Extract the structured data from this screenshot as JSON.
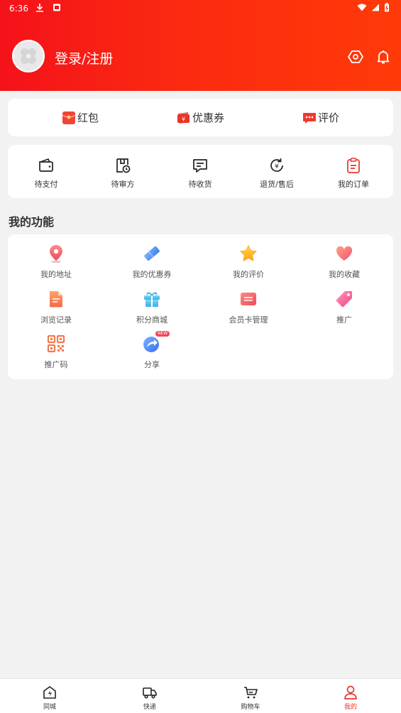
{
  "status_bar": {
    "time": "6:36"
  },
  "header": {
    "login_label": "登录/注册"
  },
  "quick_links": [
    {
      "label": "红包",
      "icon": "red-envelope-icon"
    },
    {
      "label": "优惠券",
      "icon": "coupon-icon"
    },
    {
      "label": "评价",
      "icon": "review-icon"
    }
  ],
  "orders": [
    {
      "label": "待支付",
      "icon": "wallet-icon"
    },
    {
      "label": "待审方",
      "icon": "prescription-review-icon"
    },
    {
      "label": "待收货",
      "icon": "message-icon"
    },
    {
      "label": "退货/售后",
      "icon": "refund-icon"
    },
    {
      "label": "我的订单",
      "icon": "clipboard-icon"
    }
  ],
  "functions_title": "我的功能",
  "functions": [
    {
      "label": "我的地址",
      "icon": "location-pin-icon"
    },
    {
      "label": "我的优惠券",
      "icon": "ticket-icon"
    },
    {
      "label": "我的评价",
      "icon": "star-icon"
    },
    {
      "label": "我的收藏",
      "icon": "heart-icon"
    },
    {
      "label": "浏览记录",
      "icon": "document-icon"
    },
    {
      "label": "积分商城",
      "icon": "gift-icon"
    },
    {
      "label": "会员卡管理",
      "icon": "card-icon"
    },
    {
      "label": "推广",
      "icon": "tag-icon"
    },
    {
      "label": "推广码",
      "icon": "qr-code-icon"
    },
    {
      "label": "分享",
      "icon": "share-icon",
      "badge": "NEW"
    }
  ],
  "tabs": [
    {
      "label": "同城",
      "icon": "home-bolt-icon"
    },
    {
      "label": "快递",
      "icon": "delivery-truck-icon"
    },
    {
      "label": "购物车",
      "icon": "cart-icon"
    },
    {
      "label": "我的",
      "icon": "user-icon",
      "active": true
    }
  ],
  "colors": {
    "brand_red": "#f5121a",
    "brand_orange": "#ff3a08",
    "tab_active": "#e8342b"
  }
}
